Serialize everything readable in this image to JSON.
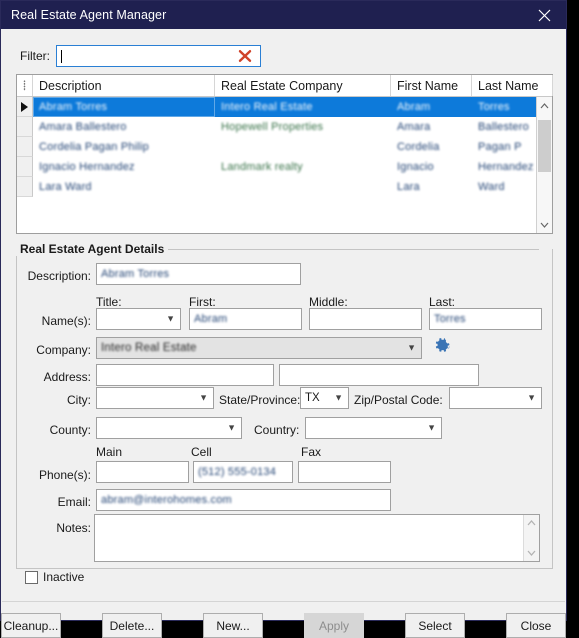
{
  "window": {
    "title": "Real Estate Agent Manager",
    "close_icon": "close-icon"
  },
  "filter": {
    "label": "Filter:",
    "value": "",
    "placeholder": "",
    "clear_icon": "red-x-clear-icon"
  },
  "grid": {
    "grip_icon": "column-grip-icon",
    "columns": [
      "Description",
      "Real Estate Company",
      "First Name",
      "Last Name"
    ],
    "rows": [
      {
        "selected": true,
        "current": true,
        "description": "Abram Torres",
        "company": "Intero Real Estate",
        "first": "Abram",
        "last": "Torres"
      },
      {
        "selected": false,
        "current": false,
        "description": "Amara Ballestero",
        "company": "Hopewell Properties",
        "first": "Amara",
        "last": "Ballestero"
      },
      {
        "selected": false,
        "current": false,
        "description": "Cordelia Pagan Philip",
        "company": "",
        "first": "Cordelia",
        "last": "Pagan P"
      },
      {
        "selected": false,
        "current": false,
        "description": "Ignacio Hernandez",
        "company": "Landmark realty",
        "first": "Ignacio",
        "last": "Hernandez"
      },
      {
        "selected": false,
        "current": false,
        "description": "Lara Ward",
        "company": "",
        "first": "Lara",
        "last": "Ward"
      }
    ],
    "scrollbar": {
      "up_icon": "chevron-up-icon",
      "down_icon": "chevron-down-icon"
    }
  },
  "details": {
    "group_title": "Real Estate Agent Details",
    "description_label": "Description:",
    "description_value": "Abram Torres",
    "names_label": "Name(s):",
    "title_label": "Title:",
    "title_value": "",
    "first_label": "First:",
    "first_value": "Abram",
    "middle_label": "Middle:",
    "middle_value": "",
    "last_label": "Last:",
    "last_value": "Torres",
    "company_label": "Company:",
    "company_value": "Intero Real Estate",
    "company_settings_icon": "gear-icon",
    "address_label": "Address:",
    "address_line1": "",
    "address_line2": "",
    "city_label": "City:",
    "city_value": "",
    "state_label": "State/Province:",
    "state_value": "TX",
    "zip_label": "Zip/Postal Code:",
    "zip_value": "",
    "county_label": "County:",
    "county_value": "",
    "country_label": "Country:",
    "country_value": "",
    "phones_label": "Phone(s):",
    "phone_main_label": "Main",
    "phone_main_value": "",
    "phone_cell_label": "Cell",
    "phone_cell_value": "(512) 555-0134",
    "phone_fax_label": "Fax",
    "phone_fax_value": "",
    "email_label": "Email:",
    "email_value": "abram@interohomes.com",
    "notes_label": "Notes:",
    "notes_value": "",
    "notes_scroll_up_icon": "chevron-up-icon",
    "notes_scroll_down_icon": "chevron-down-icon",
    "inactive_label": "Inactive",
    "inactive_checked": false
  },
  "footer": {
    "buttons": [
      {
        "label": "Cleanup...",
        "disabled": false
      },
      {
        "label": "Delete...",
        "disabled": false
      },
      {
        "label": "New...",
        "disabled": false
      },
      {
        "label": "Apply",
        "disabled": true
      },
      {
        "label": "Select",
        "disabled": false
      },
      {
        "label": "Close",
        "disabled": false
      }
    ]
  },
  "colors": {
    "titlebar": "#1f2050",
    "selection": "#0d7ada",
    "accent_focus": "#2a7fd4",
    "clear_x": "#d0432a",
    "gear": "#3a74b5"
  }
}
